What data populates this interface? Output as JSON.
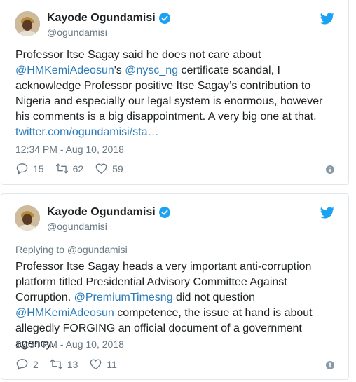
{
  "tweets": [
    {
      "name": "Kayode Ogundamisi",
      "handle": "@ogundamisi",
      "replying_to": "",
      "text_parts": [
        {
          "t": "Professor Itse Sagay said he does not care about ",
          "link": false
        },
        {
          "t": "@HMKemiAdeosun",
          "link": true
        },
        {
          "t": "'s ",
          "link": false
        },
        {
          "t": "@nysc_ng",
          "link": true
        },
        {
          "t": " certificate scandal, I acknowledge Professor positive Itse Sagay’s contribution to Nigeria and especially our legal system is enormous, however his comments is a big disappointment. A very big one at that. ",
          "link": false
        },
        {
          "t": "twitter.com/ogundamisi/sta…",
          "link": true
        }
      ],
      "timestamp": "12:34 PM - Aug 10, 2018",
      "replies": "15",
      "retweets": "62",
      "likes": "59"
    },
    {
      "name": "Kayode Ogundamisi",
      "handle": "@ogundamisi",
      "replying_to": "Replying to @ogundamisi",
      "text_parts": [
        {
          "t": "Professor Itse Sagay heads a very important anti-corruption platform titled Presidential Advisory Committee Against Corruption. ",
          "link": false
        },
        {
          "t": "@PremiumTimesng",
          "link": true
        },
        {
          "t": " did not question ",
          "link": false
        },
        {
          "t": "@HMKemiAdeosun",
          "link": true
        },
        {
          "t": " competence, the issue at hand is about allegedly FORGING an official document of a government agency.",
          "link": false
        }
      ],
      "timestamp": "12:34 PM - Aug 10, 2018",
      "replies": "2",
      "retweets": "13",
      "likes": "11"
    }
  ],
  "colors": {
    "link": "#2b7bb9",
    "verified": "#1da1f2",
    "bird": "#1da1f2",
    "muted": "#697882"
  },
  "icons": [
    "avatar",
    "verified-badge-icon",
    "twitter-bird-icon",
    "reply-icon",
    "retweet-icon",
    "heart-icon",
    "info-icon"
  ]
}
